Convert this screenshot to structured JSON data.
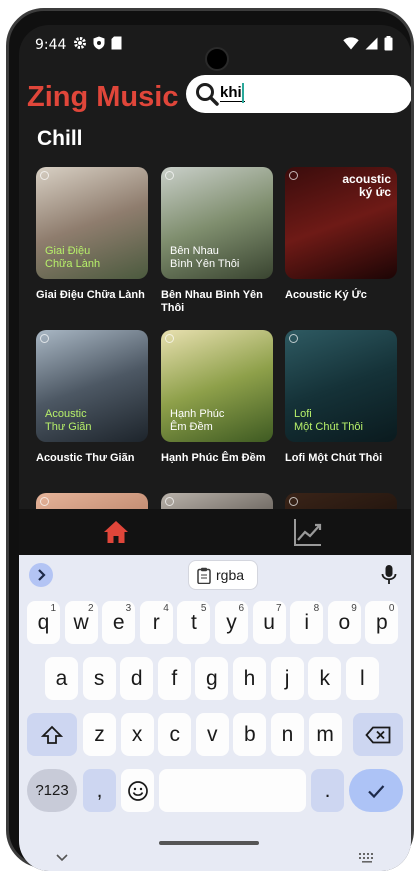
{
  "status_bar": {
    "time": "9:44",
    "left_icons": [
      "gear-icon",
      "shield-icon",
      "sd-card-icon"
    ],
    "right_icons": [
      "wifi-icon",
      "signal-icon",
      "battery-icon"
    ]
  },
  "header": {
    "app_title": "Zing Music",
    "search_value": "khi",
    "brand_color": "#e0463a"
  },
  "section_title": "Chill",
  "albums": [
    {
      "title": "Giai Điệu Chữa Lành",
      "cover_text": "Giai Điệu\nChữa Lành",
      "cover_colors": [
        "#d8d0c4",
        "#8f7d6e",
        "#4b5a3e"
      ],
      "cover_text_color": "#b7f06a"
    },
    {
      "title": "Bên Nhau Bình Yên Thôi",
      "cover_text": "Bên Nhau\nBình Yên Thôi",
      "cover_colors": [
        "#c9cfc9",
        "#7f8e6e",
        "#394430"
      ],
      "cover_text_color": "#ffffff"
    },
    {
      "title": "Acoustic Ký Ức",
      "cover_text": "acoustic\nký ức",
      "cover_colors": [
        "#3a0c0c",
        "#6e1a16",
        "#1c0505"
      ],
      "cover_text_color": "#ffffff"
    },
    {
      "title": "Acoustic Thư Giãn",
      "cover_text": "Acoustic\nThư Giãn",
      "cover_colors": [
        "#a9b7c4",
        "#4d5864",
        "#1d242b"
      ],
      "cover_text_color": "#b7f06a"
    },
    {
      "title": "Hạnh Phúc Êm Đềm",
      "cover_text": "Hạnh Phúc\nÊm Đềm",
      "cover_colors": [
        "#e8e0b0",
        "#8ea04a",
        "#3e5a22"
      ],
      "cover_text_color": "#ffffff"
    },
    {
      "title": "Lofi Một Chút Thôi",
      "cover_text": "Lofi\nMột Chút Thôi",
      "cover_colors": [
        "#2e5a62",
        "#153238",
        "#0a1a1e"
      ],
      "cover_text_color": "#b7f06a"
    },
    {
      "title": "",
      "cover_text": "",
      "cover_colors": [
        "#e6b49a",
        "#b98268",
        "#704a3a"
      ],
      "cover_text_color": "#ffffff"
    },
    {
      "title": "",
      "cover_text": "",
      "cover_colors": [
        "#b9b2aa",
        "#5c5650",
        "#2a2622"
      ],
      "cover_text_color": "#ffffff"
    },
    {
      "title": "",
      "cover_text": "",
      "cover_colors": [
        "#3a2418",
        "#1e120c",
        "#0c0806"
      ],
      "cover_text_color": "#ffffff"
    }
  ],
  "bottom_nav": {
    "items": [
      "home-icon",
      "trending-chart-icon"
    ],
    "active_color": "#e0463a",
    "inactive_color": "#9a9a9a"
  },
  "keyboard": {
    "suggestion": "rgba",
    "row1": [
      "q",
      "w",
      "e",
      "r",
      "t",
      "y",
      "u",
      "i",
      "o",
      "p"
    ],
    "row1_hints": [
      "1",
      "2",
      "3",
      "4",
      "5",
      "6",
      "7",
      "8",
      "9",
      "0"
    ],
    "row2": [
      "a",
      "s",
      "d",
      "f",
      "g",
      "h",
      "j",
      "k",
      "l"
    ],
    "row3": [
      "z",
      "x",
      "c",
      "v",
      "b",
      "n",
      "m"
    ],
    "symbols_label": "?123",
    "comma": ",",
    "period": "."
  }
}
